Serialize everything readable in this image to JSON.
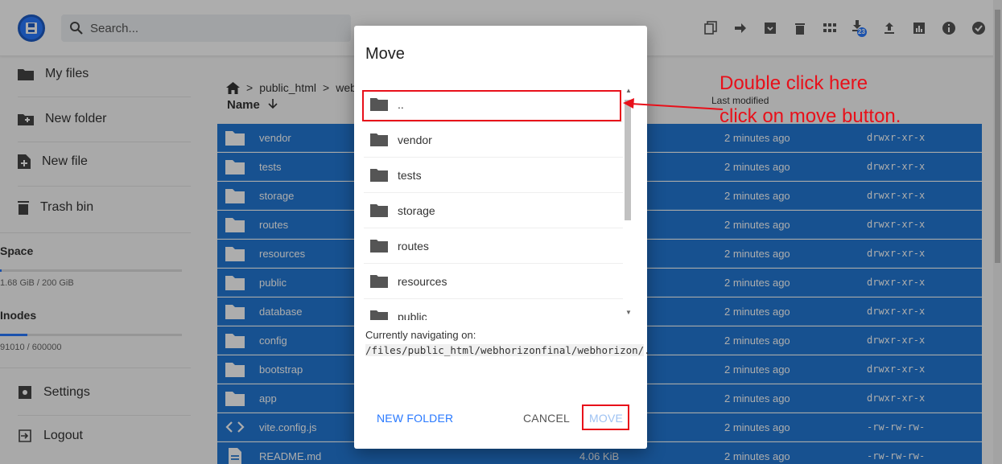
{
  "header": {
    "search_placeholder": "Search...",
    "toolbar_icons": [
      "copy-icon",
      "move-arrow-icon",
      "archive-icon",
      "trash-icon",
      "grid-view-icon",
      "download-icon",
      "upload-icon",
      "info-chart-icon",
      "info-icon",
      "check-circle-icon"
    ],
    "download_badge": "23"
  },
  "sidebar": {
    "items": [
      {
        "label": "My files",
        "icon": "folder-icon"
      },
      {
        "label": "New folder",
        "icon": "folder-plus-icon"
      },
      {
        "label": "New file",
        "icon": "file-plus-icon"
      },
      {
        "label": "Trash bin",
        "icon": "trash-icon"
      }
    ],
    "space_label": "Space",
    "space_value": "1.68 GiB / 200 GiB",
    "space_fraction": 0.0084,
    "inodes_label": "Inodes",
    "inodes_value": "91010 / 600000",
    "inodes_fraction": 0.152,
    "settings_label": "Settings",
    "logout_label": "Logout"
  },
  "breadcrumb": {
    "sep": ">",
    "items": [
      "public_html",
      "web"
    ]
  },
  "list": {
    "name_header": "Name",
    "modified_header": "Last modified",
    "rows": [
      {
        "name": "vendor",
        "icon": "folder-icon",
        "size": "",
        "modified": "2 minutes ago",
        "perms": "drwxr-xr-x"
      },
      {
        "name": "tests",
        "icon": "folder-icon",
        "size": "",
        "modified": "2 minutes ago",
        "perms": "drwxr-xr-x"
      },
      {
        "name": "storage",
        "icon": "folder-icon",
        "size": "",
        "modified": "2 minutes ago",
        "perms": "drwxr-xr-x"
      },
      {
        "name": "routes",
        "icon": "folder-icon",
        "size": "",
        "modified": "2 minutes ago",
        "perms": "drwxr-xr-x"
      },
      {
        "name": "resources",
        "icon": "folder-icon",
        "size": "",
        "modified": "2 minutes ago",
        "perms": "drwxr-xr-x"
      },
      {
        "name": "public",
        "icon": "folder-icon",
        "size": "",
        "modified": "2 minutes ago",
        "perms": "drwxr-xr-x"
      },
      {
        "name": "database",
        "icon": "folder-icon",
        "size": "",
        "modified": "2 minutes ago",
        "perms": "drwxr-xr-x"
      },
      {
        "name": "config",
        "icon": "folder-icon",
        "size": "",
        "modified": "2 minutes ago",
        "perms": "drwxr-xr-x"
      },
      {
        "name": "bootstrap",
        "icon": "folder-icon",
        "size": "",
        "modified": "2 minutes ago",
        "perms": "drwxr-xr-x"
      },
      {
        "name": "app",
        "icon": "folder-icon",
        "size": "",
        "modified": "2 minutes ago",
        "perms": "drwxr-xr-x"
      },
      {
        "name": "vite.config.js",
        "icon": "code-icon",
        "size": "",
        "modified": "2 minutes ago",
        "perms": "-rw-rw-rw-"
      },
      {
        "name": "README.md",
        "icon": "document-icon",
        "size": "4.06 KiB",
        "modified": "2 minutes ago",
        "perms": "-rw-rw-rw-"
      }
    ]
  },
  "modal": {
    "title": "Move",
    "folders": [
      "..",
      "vendor",
      "tests",
      "storage",
      "routes",
      "resources",
      "public"
    ],
    "nav_label": "Currently navigating on:",
    "nav_path": "/files/public_html/webhorizonfinal/webhorizon/",
    "nav_suffix": ".",
    "new_folder_label": "NEW FOLDER",
    "cancel_label": "CANCEL",
    "move_label": "MOVE"
  },
  "annotation": {
    "line1": "Double click here",
    "line2": "click on move button."
  },
  "colors": {
    "accent": "#2979ff",
    "selected_row": "#2278d4",
    "annotation_red": "#e8101a"
  }
}
